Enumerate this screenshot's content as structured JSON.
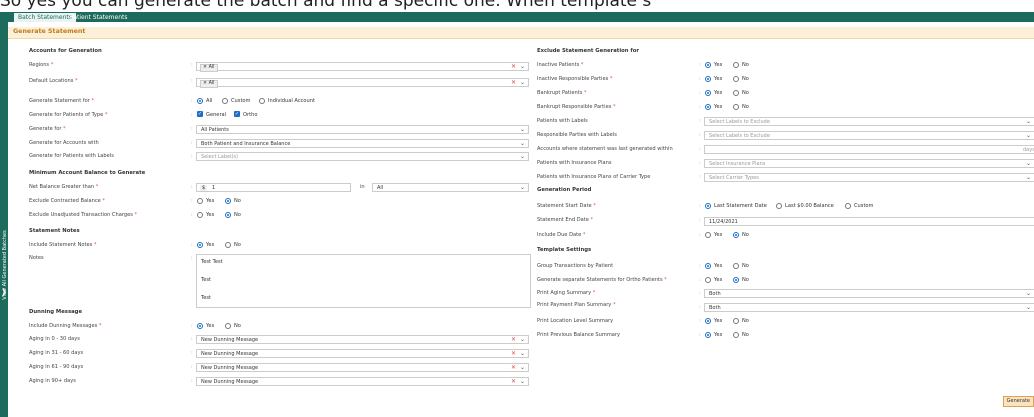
{
  "caption": "So yes you can generate the batch and find a specific one. When template s",
  "tabs": [
    "Batch Statements",
    "Patient Statements"
  ],
  "side_text": "View All Generated Batches",
  "title": "Generate Statement",
  "left": {
    "accounts_header": "Accounts for Generation",
    "regions_label": "Regions",
    "regions_value": "All",
    "default_locations_label": "Default Locations",
    "default_locations_value": "All",
    "generate_for_label": "Generate Statement for",
    "generate_for_opts": [
      "All",
      "Custom",
      "Individual Account"
    ],
    "patients_type_label": "Generate for Patients of Type",
    "patients_type_opts": [
      "General",
      "Ortho"
    ],
    "generate_for2_label": "Generate for",
    "generate_for2_value": "All Patients",
    "accounts_with_label": "Generate for Accounts with",
    "accounts_with_value": "Both Patient and Insurance Balance",
    "patients_labels_label": "Generate for Patients with Labels",
    "patients_labels_placeholder": "Select Label(s)",
    "min_balance_header": "Minimum Account Balance to Generate",
    "net_balance_label": "Net Balance Greater than",
    "net_balance_currency": "$",
    "net_balance_value": "1",
    "in_label": "in",
    "in_value": "All",
    "excl_contracted_label": "Exclude Contracted Balance",
    "excl_unadjusted_label": "Exclude Unadjusted Transaction Charges",
    "yes": "Yes",
    "no": "No",
    "notes_header": "Statement Notes",
    "include_notes_label": "Include Statement Notes",
    "notes_label": "Notes",
    "notes_lines": [
      "Test Test",
      "Test",
      "Test"
    ],
    "dunning_header": "Dunning Message",
    "include_dunning_label": "Include Dunning Messages",
    "aging": [
      {
        "label": "Aging in 0 - 30 days",
        "value": "New Dunning Message"
      },
      {
        "label": "Aging in 31 - 60 days",
        "value": "New Dunning Message"
      },
      {
        "label": "Aging in 61 - 90 days",
        "value": "New Dunning Message"
      },
      {
        "label": "Aging in 90+ days",
        "value": "New Dunning Message"
      }
    ]
  },
  "right": {
    "exclude_header": "Exclude Statement Generation for",
    "inactive_patients": "Inactive Patients",
    "inactive_rp": "Inactive Responsible Parties",
    "bankrupt_patients": "Bankrupt Patients",
    "bankrupt_rp": "Bankrupt Responsible Parties",
    "patients_labels": "Patients with Labels",
    "patients_labels_ph": "Select Labels to Exclude",
    "rp_labels": "Responsible Parties with Labels",
    "rp_labels_ph": "Select Labels to Exclude",
    "last_generated": "Accounts where statement was last generated within",
    "days": "days",
    "ins_plans": "Patients with Insurance Plans",
    "ins_plans_ph": "Select Insurance Plans",
    "carrier_type": "Patients with Insurance Plans of Carrier Type",
    "carrier_type_ph": "Select Carrier Types",
    "period_header": "Generation Period",
    "start_date": "Statement Start Date",
    "start_opts": [
      "Last Statement Date",
      "Last $0.00 Balance",
      "Custom"
    ],
    "end_date": "Statement End Date",
    "end_date_value": "11/24/2021",
    "include_due": "Include Due Date",
    "template_header": "Template Settings",
    "group_tx": "Group Transactions by Patient",
    "separate_ortho": "Generate separate Statements for Ortho Patients",
    "print_aging": "Print Aging Summary",
    "print_aging_value": "Both",
    "print_payment": "Print Payment Plan Summary",
    "print_payment_value": "Both",
    "print_location": "Print Location Level Summary",
    "print_prev": "Print Previous Balance Summary"
  },
  "generate_button": "Generate"
}
